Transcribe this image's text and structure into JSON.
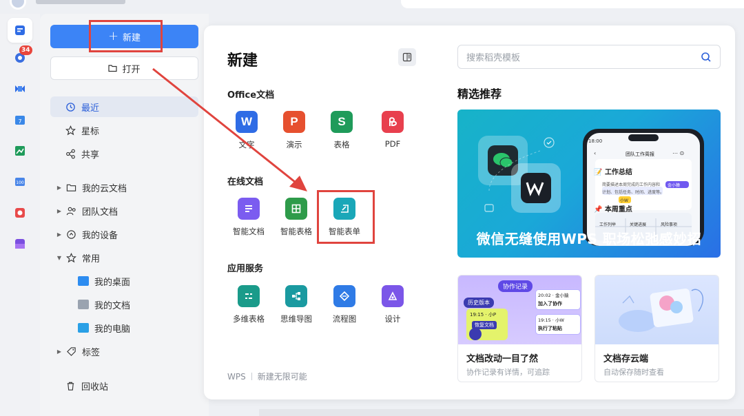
{
  "sidebar": {
    "new_label": "新建",
    "open_label": "打开",
    "nav": [
      {
        "label": "最近",
        "icon": "clock-icon"
      },
      {
        "label": "星标",
        "icon": "star-icon"
      },
      {
        "label": "共享",
        "icon": "share-icon"
      },
      {
        "label": "我的云文档",
        "icon": "folder-icon"
      },
      {
        "label": "团队文档",
        "icon": "team-icon"
      },
      {
        "label": "我的设备",
        "icon": "device-icon"
      },
      {
        "label": "常用",
        "icon": "pin-icon"
      },
      {
        "label": "标签",
        "icon": "tag-icon"
      },
      {
        "label": "回收站",
        "icon": "trash-icon"
      }
    ],
    "common_items": [
      {
        "label": "我的桌面",
        "color": "#2d8cf0"
      },
      {
        "label": "我的文档",
        "color": "#9aa3b0"
      },
      {
        "label": "我的电脑",
        "color": "#2aa0e6"
      }
    ]
  },
  "rail": {
    "badge_count": "34"
  },
  "panel": {
    "title": "新建",
    "sections": {
      "office": "Office文档",
      "online": "在线文档",
      "apps": "应用服务"
    },
    "office_tiles": [
      {
        "label": "文字",
        "glyph": "W",
        "color": "#2f6ce5"
      },
      {
        "label": "演示",
        "glyph": "P",
        "color": "#e6502f"
      },
      {
        "label": "表格",
        "glyph": "S",
        "color": "#1f9b5a"
      },
      {
        "label": "PDF",
        "glyph": "P",
        "color": "#e8404e"
      }
    ],
    "online_tiles": [
      {
        "label": "智能文档",
        "color": "#7b5cf0"
      },
      {
        "label": "智能表格",
        "color": "#2e9b4a"
      },
      {
        "label": "智能表单",
        "color": "#1aa7b8"
      }
    ],
    "app_tiles": [
      {
        "label": "多维表格",
        "color": "#1a9b8a"
      },
      {
        "label": "思维导图",
        "color": "#1a9aa0"
      },
      {
        "label": "流程图",
        "color": "#2f7be6"
      },
      {
        "label": "设计",
        "color": "#7b56e8"
      }
    ],
    "footer_brand": "WPS",
    "footer_text": "新建无限可能"
  },
  "search": {
    "placeholder": "搜索稻壳模板"
  },
  "recommend": {
    "title": "精选推荐",
    "banner_text": "微信无缝使用WPS 职场松弛感妙招",
    "phone": {
      "time": "18:00",
      "header": "团队工作周报",
      "section1": "工作总结",
      "line1": "简要描述本周完成的工作内容和",
      "line2": "计划、包括任务、时间、进度等。",
      "tag1": "金小猿",
      "tag2": "小W",
      "section2": "本周重点",
      "col1": "工作列举",
      "col2": "关键进展",
      "col3": "风险事项"
    },
    "cards": [
      {
        "title": "文档改动一目了然",
        "sub": "协作记录有详情，可追踪"
      },
      {
        "title": "文档存云端",
        "sub": "自动保存随时查看"
      }
    ],
    "collab": {
      "tag_main": "协作记录",
      "tag_hist": "历史版本",
      "t1": "20:02",
      "u1": "金小猿",
      "a1": "加入了协作",
      "t2": "19:15",
      "u2": "小P",
      "a2": "恢复文档",
      "t3": "19:15",
      "u3": "小W",
      "a3": "执行了粘贴"
    }
  },
  "colors": {
    "accent": "#3c84f6",
    "annotation": "#e0443e"
  }
}
